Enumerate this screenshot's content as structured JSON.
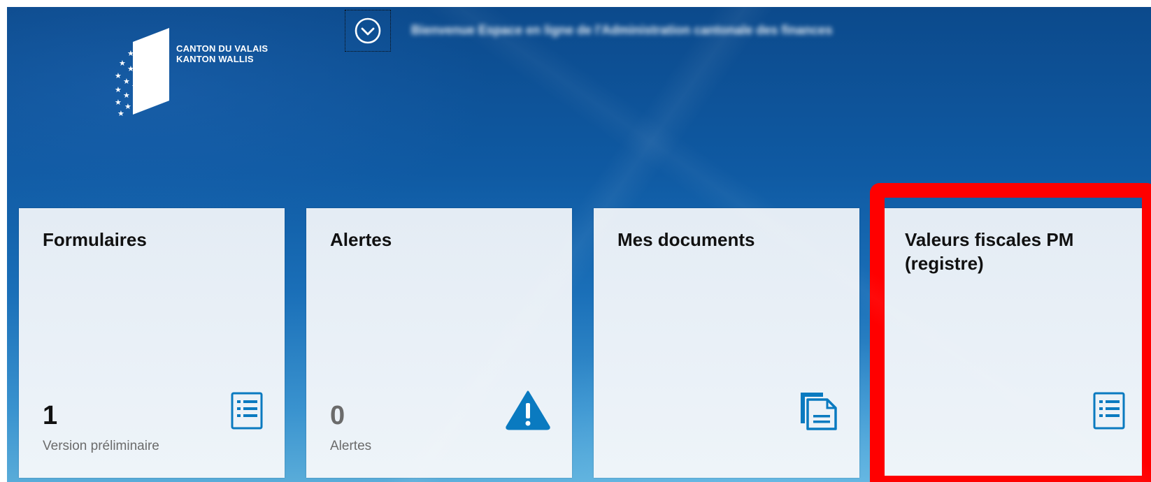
{
  "header": {
    "logo_line1": "CANTON DU VALAIS",
    "logo_line2": "KANTON WALLIS",
    "blurred_text": "Bienvenue Espace en ligne de l'Administration cantonale des finances"
  },
  "tiles": [
    {
      "title": "Formulaires",
      "count": "1",
      "subtitle": "Version préliminaire",
      "icon": "list-document-icon"
    },
    {
      "title": "Alertes",
      "count": "0",
      "subtitle": "Alertes",
      "icon": "warning-icon"
    },
    {
      "title": "Mes documents",
      "icon": "documents-icon"
    },
    {
      "title": "Valeurs fiscales PM (registre)",
      "icon": "list-document-icon"
    }
  ],
  "colors": {
    "accent": "#0a7ac0",
    "highlight": "#ff0000",
    "tile_bg": "#e9f0f7"
  }
}
